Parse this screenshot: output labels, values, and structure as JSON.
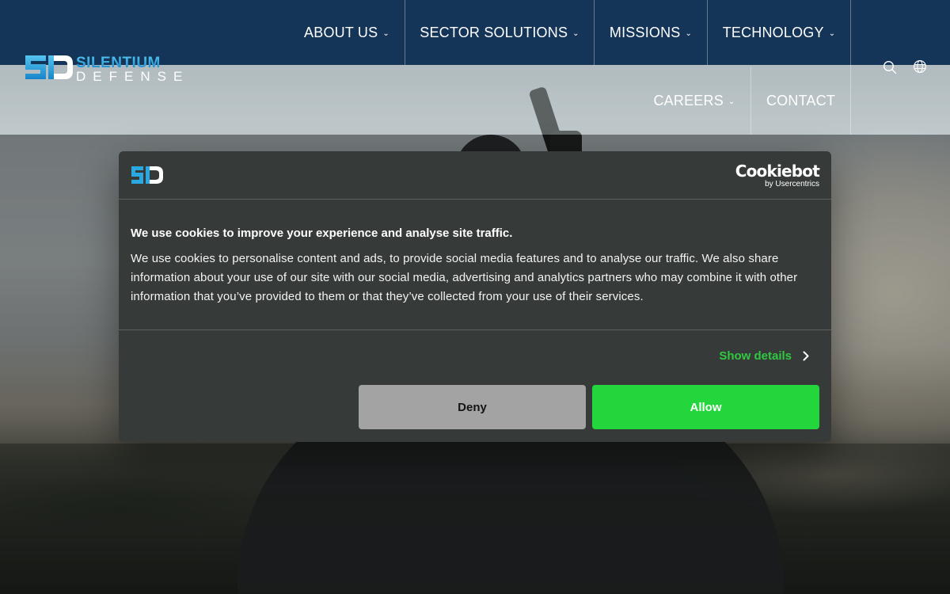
{
  "brand": {
    "logo_mark": "SD",
    "logo_line1": "SILENTIUM",
    "logo_line2": "DEFENSE",
    "colors": {
      "header_bg": "#143557",
      "logo_blue": "#1ea7e0",
      "accept_green": "#23d63c",
      "details_green": "#30c941"
    }
  },
  "nav": {
    "items": [
      {
        "label": "ABOUT US",
        "has_dropdown": true
      },
      {
        "label": "SECTOR SOLUTIONS",
        "has_dropdown": true
      },
      {
        "label": "MISSIONS",
        "has_dropdown": true
      },
      {
        "label": "TECHNOLOGY",
        "has_dropdown": true
      },
      {
        "label": "CAREERS",
        "has_dropdown": true
      },
      {
        "label": "CONTACT",
        "has_dropdown": false
      }
    ],
    "chevron_glyph": "⌄",
    "utility_icons": [
      "search-icon",
      "globe-icon"
    ]
  },
  "cookie_dialog": {
    "provider_name": "Cookiebot",
    "provider_by": "by Usercentrics",
    "title": "We use cookies to improve your experience and analyse site traffic.",
    "body": "We use cookies to personalise content and ads, to provide social media features and to analyse our traffic. We also share information about your use of our site with our social media, advertising and analytics partners who may combine it with other information that you’ve provided to them or that they’ve collected from your use of their services.",
    "show_details_label": "Show details",
    "deny_label": "Deny",
    "allow_label": "Allow"
  }
}
